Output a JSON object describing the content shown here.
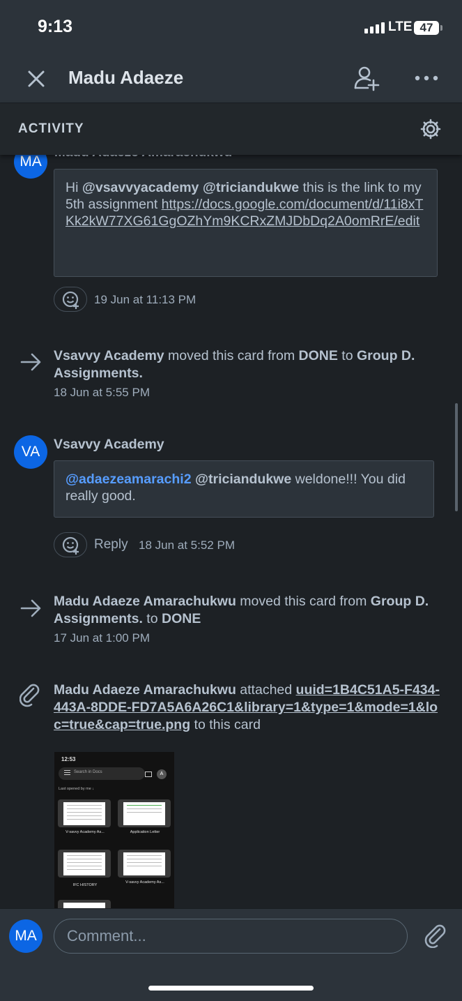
{
  "status": {
    "time": "9:13",
    "network": "LTE",
    "battery": "47"
  },
  "header": {
    "title": "Madu Adaeze"
  },
  "activity": {
    "title": "ACTIVITY"
  },
  "feed": {
    "comment1": {
      "avatar": "MA",
      "author_cut": "Madu Adaeze Amarachukwu",
      "greeting": "Hi ",
      "mention1": "@vsavvyacademy",
      "mention2": "@triciandukwe",
      "text_mid": "  this is the link to my 5th assignment ",
      "link": "https://docs.google.com/document/d/11i8xTKk2kW77XG61GgOZhYm9KCRxZMJDbDq2A0omRrE/edit",
      "timestamp": "19 Jun at 11:13 PM"
    },
    "move1": {
      "actor": "Vsavvy Academy",
      "text1": " moved this card from ",
      "from": "DONE",
      "text2": " to ",
      "to": "Group D. Assignments.",
      "timestamp": "18 Jun at 5:55 PM"
    },
    "comment2": {
      "avatar": "VA",
      "author": "Vsavvy Academy",
      "mention1": "@adaezeamarachi2",
      "mention2": "@triciandukwe",
      "text": " weldone!!! You did really good.",
      "reply": "Reply",
      "timestamp": "18 Jun at 5:52 PM"
    },
    "move2": {
      "actor": "Madu Adaeze Amarachukwu",
      "text1": " moved this card from ",
      "from": "Group D. Assignments.",
      "text2": " to ",
      "to": "DONE",
      "timestamp": "17 Jun at 1:00 PM"
    },
    "attach": {
      "actor": "Madu Adaeze Amarachukwu",
      "text1": " attached ",
      "filename": "uuid=1B4C51A5-F434-443A-8DDE-FD7A5A6A26C1&library=1&type=1&mode=1&loc=true&cap=true.png",
      "text2": " to this card",
      "preview": {
        "time": "12:53",
        "search": "Search in Docs",
        "account": "A",
        "section": "Last opened by me ↓",
        "docs": [
          "V-savvy Academy As...",
          "Application Letter",
          "IFC HISTORY",
          "V-savvy Academy As..."
        ]
      }
    }
  },
  "composer": {
    "avatar": "MA",
    "placeholder": "Comment..."
  },
  "colors": {
    "accent": "#0c66e4",
    "mention": "#579dff",
    "background": "#1d2125"
  },
  "icons": [
    "close-icon",
    "add-member-icon",
    "more-icon",
    "settings-gear-icon",
    "emoji-add-icon",
    "move-arrow-icon",
    "attachment-icon"
  ]
}
